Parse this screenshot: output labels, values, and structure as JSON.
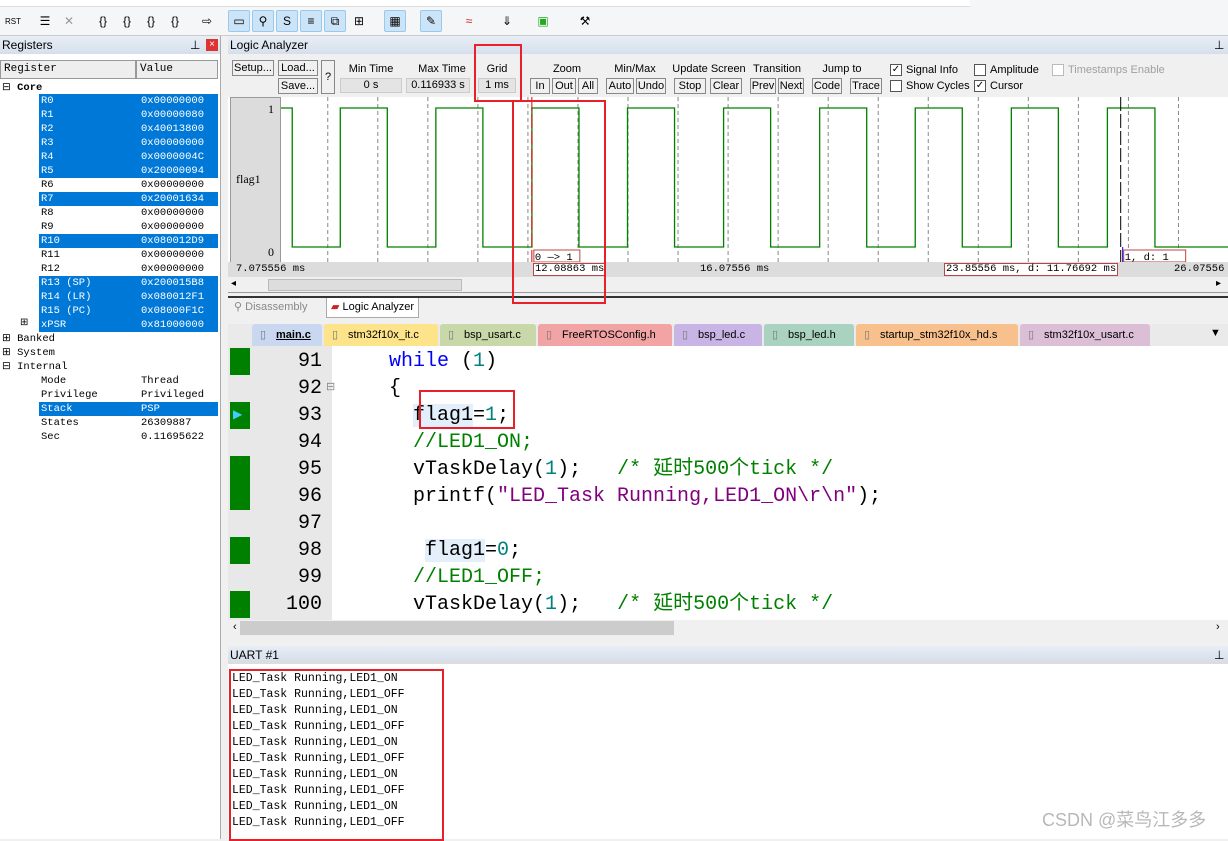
{
  "toolbar": {
    "icons": [
      "reset-icon",
      "disassembly-list-icon",
      "stop-icon",
      "step-into-icon",
      "step-over-icon",
      "step-out-icon",
      "run-to-cursor-icon",
      "show-next-statement-icon",
      "command-window-icon",
      "disassembly-window-icon",
      "symbols-window-icon",
      "registers-window-icon",
      "call-stack-icon",
      "watch-window-icon",
      "memory-window-icon",
      "serial-window-icon",
      "analysis-window-icon",
      "trace-window-icon",
      "system-viewer-icon",
      "toolbox-icon"
    ],
    "rst_label": "RST"
  },
  "registers": {
    "title": "Registers",
    "col_register": "Register",
    "col_value": "Value",
    "core_label": "Core",
    "core": [
      {
        "name": "R0",
        "value": "0x00000000",
        "selected": true
      },
      {
        "name": "R1",
        "value": "0x00000080",
        "selected": true
      },
      {
        "name": "R2",
        "value": "0x40013800",
        "selected": true
      },
      {
        "name": "R3",
        "value": "0x00000000",
        "selected": true
      },
      {
        "name": "R4",
        "value": "0x0000004C",
        "selected": true
      },
      {
        "name": "R5",
        "value": "0x20000094",
        "selected": true
      },
      {
        "name": "R6",
        "value": "0x00000000",
        "selected": false
      },
      {
        "name": "R7",
        "value": "0x20001634",
        "selected": true
      },
      {
        "name": "R8",
        "value": "0x00000000",
        "selected": false
      },
      {
        "name": "R9",
        "value": "0x00000000",
        "selected": false
      },
      {
        "name": "R10",
        "value": "0x080012D9",
        "selected": true
      },
      {
        "name": "R11",
        "value": "0x00000000",
        "selected": false
      },
      {
        "name": "R12",
        "value": "0x00000000",
        "selected": false
      },
      {
        "name": "R13 (SP)",
        "value": "0x200015B8",
        "selected": true
      },
      {
        "name": "R14 (LR)",
        "value": "0x080012F1",
        "selected": true
      },
      {
        "name": "R15 (PC)",
        "value": "0x08000F1C",
        "selected": true
      },
      {
        "name": "xPSR",
        "value": "0x81000000",
        "selected": true
      }
    ],
    "groups": [
      "Banked",
      "System",
      "Internal"
    ],
    "internal": [
      {
        "name": "Mode",
        "value": "Thread",
        "selected": false
      },
      {
        "name": "Privilege",
        "value": "Privileged",
        "selected": false
      },
      {
        "name": "Stack",
        "value": "PSP",
        "selected": true
      },
      {
        "name": "States",
        "value": "26309887",
        "selected": false
      },
      {
        "name": "Sec",
        "value": "0.11695622",
        "selected": false
      }
    ]
  },
  "logic_analyzer": {
    "title": "Logic Analyzer",
    "setup": "Setup...",
    "load": "Load...",
    "save": "Save...",
    "help": "?",
    "min_time_label": "Min Time",
    "min_time": "0 s",
    "max_time_label": "Max Time",
    "max_time": "0.116933 s",
    "grid_label": "Grid",
    "grid": "1 ms",
    "zoom_label": "Zoom",
    "zoom_in": "In",
    "zoom_out": "Out",
    "zoom_all": "All",
    "minmax_label": "Min/Max",
    "auto": "Auto",
    "undo": "Undo",
    "update_label": "Update Screen",
    "stop": "Stop",
    "clear": "Clear",
    "transition_label": "Transition",
    "prev": "Prev",
    "next": "Next",
    "jump_label": "Jump to",
    "code": "Code",
    "trace": "Trace",
    "signal_info": {
      "label": "Signal Info",
      "checked": true
    },
    "amplitude": {
      "label": "Amplitude",
      "checked": false
    },
    "timestamps": {
      "label": "Timestamps Enable",
      "checked": false,
      "disabled": true
    },
    "show_cycles": {
      "label": "Show Cycles",
      "checked": false
    },
    "cursor": {
      "label": "Cursor",
      "checked": true
    },
    "signal": "flag1",
    "y_high": "1",
    "y_low": "0",
    "time_start": "7.075556 ms",
    "time_mid": "16.07556 ms",
    "time_end": "26.07556",
    "cursor_time": "12.08863 ms",
    "cursor_transition": "0 —> 1",
    "marker_info": "23.85556 ms,  d: 11.76692 ms",
    "marker_value": "1,  d: 1",
    "colors": {
      "signal": "#008000",
      "cursor": "#e00000",
      "marker": "#0000ff"
    }
  },
  "chart_data": {
    "type": "line",
    "signal": "flag1",
    "xlim": [
      7.075556,
      26.0
    ],
    "ylim": [
      0,
      1
    ],
    "grid_ms": 1,
    "initial_value": 1,
    "transitions_ms": [
      7.3,
      8.26,
      9.2,
      10.17,
      11.11,
      12.09,
      13.03,
      14.0,
      14.94,
      15.92,
      16.86,
      17.84,
      18.78,
      19.75,
      20.69,
      21.67,
      22.61,
      23.59,
      24.54
    ]
  },
  "bottom_tabs": [
    {
      "label": "Disassembly",
      "active": false
    },
    {
      "label": "Logic Analyzer",
      "active": true
    }
  ],
  "file_tabs": [
    {
      "label": "main.c",
      "color": "#c9d8f0",
      "active": true
    },
    {
      "label": "stm32f10x_it.c",
      "color": "#fde38a"
    },
    {
      "label": "bsp_usart.c",
      "color": "#c8d8a8"
    },
    {
      "label": "FreeRTOSConfig.h",
      "color": "#f2a3a3"
    },
    {
      "label": "bsp_led.c",
      "color": "#c9b4e6"
    },
    {
      "label": "bsp_led.h",
      "color": "#a9d3c0"
    },
    {
      "label": "startup_stm32f10x_hd.s",
      "color": "#f8c08c"
    },
    {
      "label": "stm32f10x_usart.c",
      "color": "#dcbfd6"
    }
  ],
  "code": {
    "lines": [
      {
        "n": "91",
        "html": "    <span class='kw'>while</span> (<span class='num'>1</span>)",
        "mark": true
      },
      {
        "n": "92",
        "html": "    {",
        "mark": false,
        "fold": true
      },
      {
        "n": "93",
        "html": "      <span style='background:#e3effb'>flag1</span>=<span class='num'>1</span>;",
        "mark": true,
        "current": true
      },
      {
        "n": "94",
        "html": "      <span class='cm'>//LED1_ON;</span>",
        "mark": false
      },
      {
        "n": "95",
        "html": "      vTaskDelay(<span class='num'>1</span>);   <span class='cm'>/* 延时500个tick */</span>",
        "mark": true
      },
      {
        "n": "96",
        "html": "      printf(<span class='str'>\"LED_Task Running,LED1_ON\\r\\n\"</span>);",
        "mark": true
      },
      {
        "n": "97",
        "html": "",
        "mark": false
      },
      {
        "n": "98",
        "html": "       <span style='background:#e3effb'>flag1</span>=<span class='num'>0</span>;",
        "mark": true
      },
      {
        "n": "99",
        "html": "      <span class='cm'>//LED1_OFF;</span>",
        "mark": false
      },
      {
        "n": "100",
        "html": "      vTaskDelay(<span class='num'>1</span>);   <span class='cm'>/* 延时500个tick */</span>",
        "mark": true
      }
    ]
  },
  "uart": {
    "title": "UART #1",
    "lines": [
      "LED_Task Running,LED1_ON",
      "LED_Task Running,LED1_OFF",
      "LED_Task Running,LED1_ON",
      "LED_Task Running,LED1_OFF",
      "LED_Task Running,LED1_ON",
      "LED_Task Running,LED1_OFF",
      "LED_Task Running,LED1_ON",
      "LED_Task Running,LED1_OFF",
      "LED_Task Running,LED1_ON",
      "LED_Task Running,LED1_OFF"
    ]
  },
  "watermark": "CSDN @菜鸟江多多"
}
